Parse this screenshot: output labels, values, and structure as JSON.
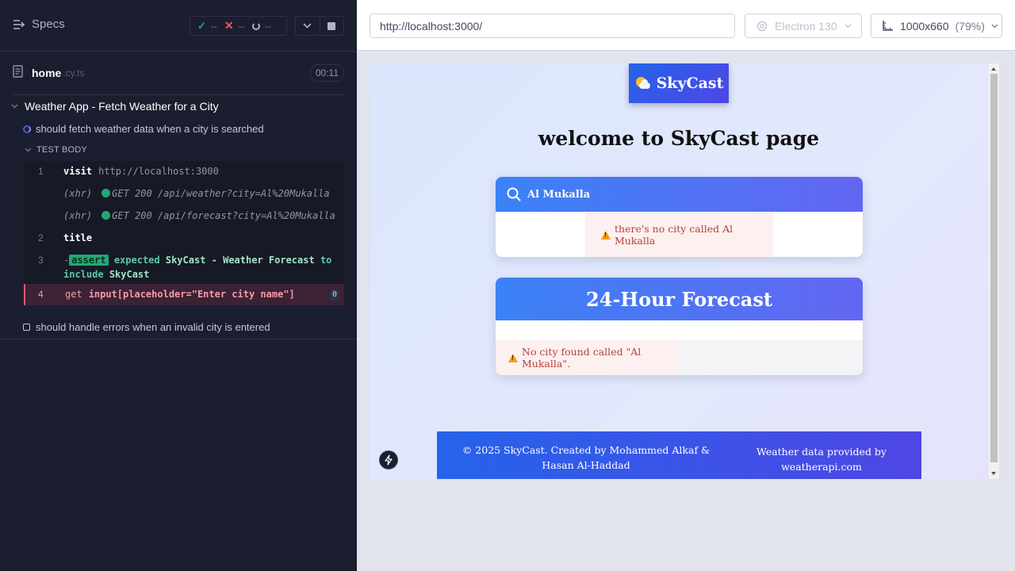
{
  "reporter": {
    "specs_label": "Specs",
    "stats": {
      "passed": "--",
      "failed": "--",
      "pending": "--"
    },
    "file": {
      "name": "home",
      "ext": ".cy.ts",
      "duration": "00:11"
    },
    "suite_title": "Weather App - Fetch Weather for a City",
    "tests": [
      {
        "title": "should fetch weather data when a city is searched",
        "state": "running"
      },
      {
        "title": "should handle errors when an invalid city is entered",
        "state": "pending"
      }
    ],
    "test_body_label": "TEST BODY",
    "commands": {
      "c1_num": "1",
      "c1_name": "visit",
      "c1_msg": "http://localhost:3000",
      "x1_prefix": "(xhr)",
      "x1_msg": "GET 200 /api/weather?city=Al%20Mukalla",
      "x2_prefix": "(xhr)",
      "x2_msg": "GET 200 /api/forecast?city=Al%20Mukalla",
      "c2_num": "2",
      "c2_name": "title",
      "c3_num": "3",
      "c3_dash": "-",
      "c3_badge": "assert",
      "c3_expected": "expected",
      "c3_value": "SkyCast - Weather Forecast",
      "c3_to": "to",
      "c3_include": "include",
      "c3_include_value": "SkyCast",
      "c4_num": "4",
      "c4_name": "get",
      "c4_selector": "input[placeholder=\"Enter city name\"]",
      "c4_count": "0"
    }
  },
  "aut": {
    "url": "http://localhost:3000/",
    "browser": "Electron 130",
    "viewport": "1000x660",
    "viewport_pct": "(79%)"
  },
  "app": {
    "logo_text": "SkyCast",
    "welcome": "welcome to SkyCast page",
    "search_value": "Al Mukalla",
    "search_error": "there's no city called Al Mukalla",
    "forecast_title": "24-Hour Forecast",
    "forecast_error": "No city found called \"Al Mukalla\".",
    "footer_left": "© 2025 SkyCast. Created by Mohammed Alkaf & Hasan Al-Haddad",
    "footer_right": "Weather data provided by weatherapi.com"
  },
  "colors": {
    "reporter_bg": "#1b1e2e",
    "pass": "#1fa971",
    "fail": "#e45770",
    "brand_gradient_start": "#2563eb",
    "brand_gradient_end": "#4f46e5",
    "error_text": "#b3413a"
  }
}
